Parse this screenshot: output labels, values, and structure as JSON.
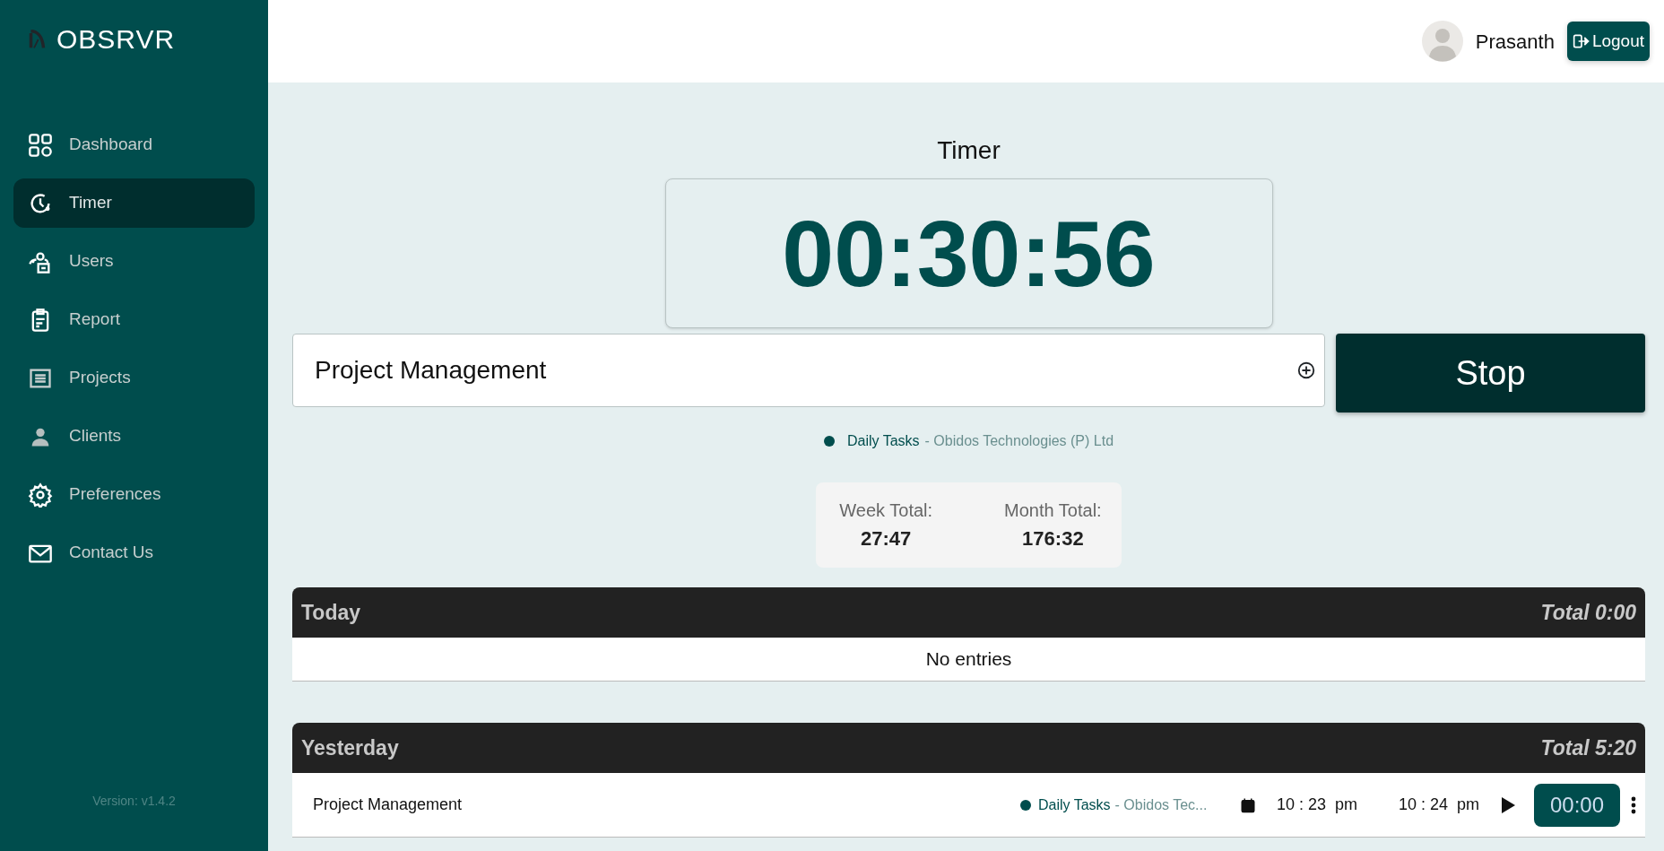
{
  "brand": {
    "name": "OBSRVR"
  },
  "sidebar": {
    "items": [
      {
        "label": "Dashboard",
        "selected": false
      },
      {
        "label": "Timer",
        "selected": true
      },
      {
        "label": "Users",
        "selected": false
      },
      {
        "label": "Report",
        "selected": false
      },
      {
        "label": "Projects",
        "selected": false
      },
      {
        "label": "Clients",
        "selected": false
      },
      {
        "label": "Preferences",
        "selected": false
      },
      {
        "label": "Contact Us",
        "selected": false
      }
    ],
    "version": "Version: v1.4.2"
  },
  "header": {
    "user": "Prasanth",
    "logout": "Logout"
  },
  "timer": {
    "title": "Timer",
    "display": "00:30:56",
    "task": "Project Management",
    "button": "Stop",
    "project": "Daily Tasks",
    "client": "- Obidos Technologies (P) Ltd"
  },
  "totals": [
    {
      "label": "Week Total:",
      "value": "27:47"
    },
    {
      "label": "Month Total:",
      "value": "176:32"
    }
  ],
  "days": [
    {
      "title": "Today",
      "total": "Total 0:00",
      "empty": "No entries"
    },
    {
      "title": "Yesterday",
      "total": "Total 5:20",
      "entries": [
        {
          "task": "Project Management",
          "project": "Daily Tasks",
          "client": "- Obidos Tec...",
          "start": "10 : 23  pm",
          "end": "10 : 24  pm",
          "duration": "00:00"
        }
      ]
    }
  ]
}
